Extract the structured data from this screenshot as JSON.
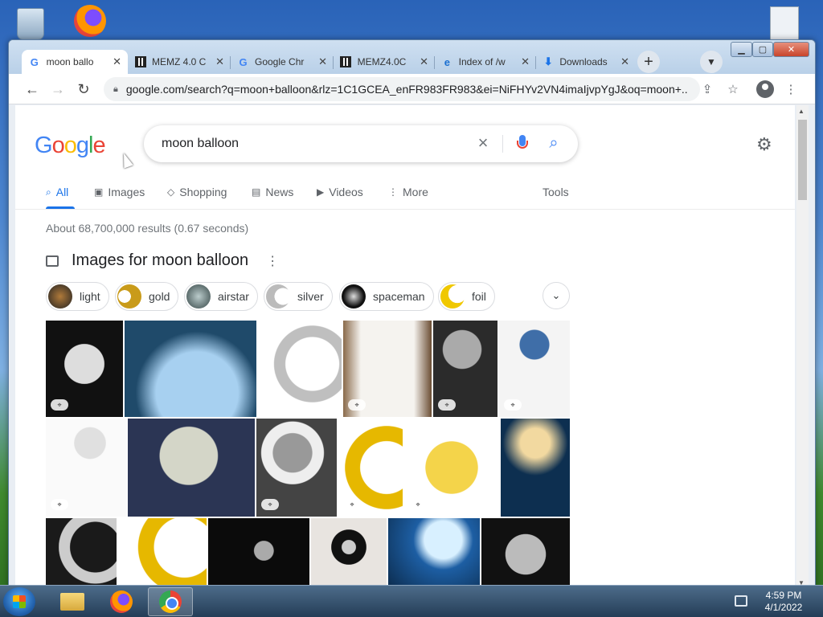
{
  "tabs": [
    {
      "label": "moon ballo",
      "icon": "google-icon",
      "active": true
    },
    {
      "label": "MEMZ 4.0 C",
      "icon": "memz-icon"
    },
    {
      "label": "Google Chr",
      "icon": "google-icon"
    },
    {
      "label": "MEMZ4.0C",
      "icon": "memz-icon"
    },
    {
      "label": "Index of /w",
      "icon": "ie-icon"
    },
    {
      "label": "Downloads",
      "icon": "download-icon"
    }
  ],
  "toolbar": {
    "url": "google.com/search?q=moon+balloon&rlz=1C1GCEA_enFR983FR983&ei=NiFHYv2VN4imaIjvpYgJ&oq=moon+..."
  },
  "search": {
    "logo": "Google",
    "query": "moon balloon"
  },
  "nav": {
    "all": "All",
    "images": "Images",
    "shopping": "Shopping",
    "news": "News",
    "videos": "Videos",
    "more": "More",
    "tools": "Tools"
  },
  "results": {
    "stats": "About 68,700,000 results (0.67 seconds)",
    "images_header": "Images for moon balloon"
  },
  "chips": [
    "light",
    "gold",
    "airstar",
    "silver",
    "spaceman",
    "foil"
  ],
  "taskbar": {
    "time": "4:59 PM",
    "date": "4/1/2022"
  },
  "colors": {
    "google_blue": "#4285f4",
    "accent": "#1a73e8"
  }
}
